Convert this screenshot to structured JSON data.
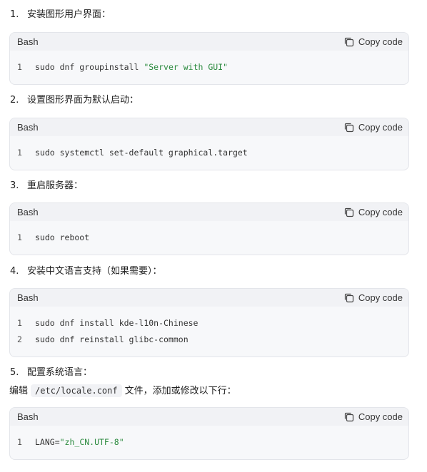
{
  "steps": [
    {
      "number": "1.",
      "title": "安装图形用户界面：",
      "lang": "Bash",
      "copy_label": "Copy code",
      "lines": [
        {
          "ln": "1",
          "prefix": "sudo dnf groupinstall ",
          "str": "\"Server with GUI\"",
          "suffix": ""
        }
      ]
    },
    {
      "number": "2.",
      "title": "设置图形界面为默认启动：",
      "lang": "Bash",
      "copy_label": "Copy code",
      "lines": [
        {
          "ln": "1",
          "prefix": "sudo systemctl set-default graphical.target",
          "str": "",
          "suffix": ""
        }
      ]
    },
    {
      "number": "3.",
      "title": "重启服务器：",
      "lang": "Bash",
      "copy_label": "Copy code",
      "lines": [
        {
          "ln": "1",
          "prefix": "sudo reboot",
          "str": "",
          "suffix": ""
        }
      ]
    },
    {
      "number": "4.",
      "title": "安装中文语言支持（如果需要）：",
      "lang": "Bash",
      "copy_label": "Copy code",
      "lines": [
        {
          "ln": "1",
          "prefix": "sudo dnf install kde-l10n-Chinese",
          "str": "",
          "suffix": ""
        },
        {
          "ln": "2",
          "prefix": "sudo dnf reinstall glibc-common",
          "str": "",
          "suffix": ""
        }
      ]
    },
    {
      "number": "5.",
      "title": "配置系统语言：",
      "lang": "Bash",
      "copy_label": "Copy code",
      "lines": [
        {
          "ln": "1",
          "prefix": "LANG=",
          "str": "\"zh_CN.UTF-8\"",
          "suffix": ""
        }
      ]
    }
  ],
  "step5_para": {
    "before": "编辑",
    "code": "/etc/locale.conf",
    "after": "文件，添加或修改以下行："
  },
  "colors": {
    "string": "#2b8a3e",
    "card_bg": "#f7f8fa",
    "header_bg": "#f1f2f5",
    "border": "#e3e5ea"
  },
  "icons": {
    "copy": "copy-icon"
  }
}
